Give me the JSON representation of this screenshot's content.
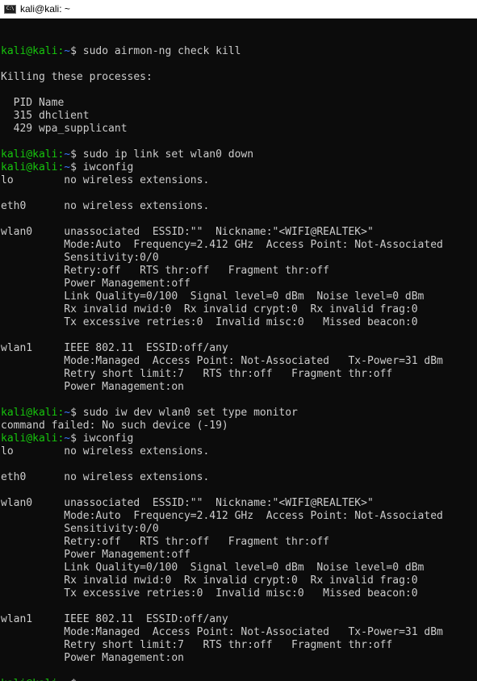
{
  "window": {
    "title": "kali@kali: ~",
    "icon_text": "C:\\"
  },
  "prompt": {
    "user": "kali@kali",
    "sep": ":",
    "path": "~",
    "symbol": "$"
  },
  "lines": [
    {
      "type": "blank"
    },
    {
      "type": "cmd",
      "cmd": " sudo airmon-ng check kill"
    },
    {
      "type": "blank"
    },
    {
      "type": "out",
      "text": "Killing these processes:"
    },
    {
      "type": "blank"
    },
    {
      "type": "out",
      "text": "  PID Name"
    },
    {
      "type": "out",
      "text": "  315 dhclient"
    },
    {
      "type": "out",
      "text": "  429 wpa_supplicant"
    },
    {
      "type": "blank"
    },
    {
      "type": "cmd",
      "cmd": " sudo ip link set wlan0 down"
    },
    {
      "type": "cmd",
      "cmd": " iwconfig"
    },
    {
      "type": "out",
      "text": "lo        no wireless extensions."
    },
    {
      "type": "blank"
    },
    {
      "type": "out",
      "text": "eth0      no wireless extensions."
    },
    {
      "type": "blank"
    },
    {
      "type": "out",
      "text": "wlan0     unassociated  ESSID:\"\"  Nickname:\"<WIFI@REALTEK>\""
    },
    {
      "type": "out",
      "text": "          Mode:Auto  Frequency=2.412 GHz  Access Point: Not-Associated"
    },
    {
      "type": "out",
      "text": "          Sensitivity:0/0"
    },
    {
      "type": "out",
      "text": "          Retry:off   RTS thr:off   Fragment thr:off"
    },
    {
      "type": "out",
      "text": "          Power Management:off"
    },
    {
      "type": "out",
      "text": "          Link Quality=0/100  Signal level=0 dBm  Noise level=0 dBm"
    },
    {
      "type": "out",
      "text": "          Rx invalid nwid:0  Rx invalid crypt:0  Rx invalid frag:0"
    },
    {
      "type": "out",
      "text": "          Tx excessive retries:0  Invalid misc:0   Missed beacon:0"
    },
    {
      "type": "blank"
    },
    {
      "type": "out",
      "text": "wlan1     IEEE 802.11  ESSID:off/any"
    },
    {
      "type": "out",
      "text": "          Mode:Managed  Access Point: Not-Associated   Tx-Power=31 dBm"
    },
    {
      "type": "out",
      "text": "          Retry short limit:7   RTS thr:off   Fragment thr:off"
    },
    {
      "type": "out",
      "text": "          Power Management:on"
    },
    {
      "type": "blank"
    },
    {
      "type": "cmd",
      "cmd": " sudo iw dev wlan0 set type monitor"
    },
    {
      "type": "out",
      "text": "command failed: No such device (-19)"
    },
    {
      "type": "cmd",
      "cmd": " iwconfig"
    },
    {
      "type": "out",
      "text": "lo        no wireless extensions."
    },
    {
      "type": "blank"
    },
    {
      "type": "out",
      "text": "eth0      no wireless extensions."
    },
    {
      "type": "blank"
    },
    {
      "type": "out",
      "text": "wlan0     unassociated  ESSID:\"\"  Nickname:\"<WIFI@REALTEK>\""
    },
    {
      "type": "out",
      "text": "          Mode:Auto  Frequency=2.412 GHz  Access Point: Not-Associated"
    },
    {
      "type": "out",
      "text": "          Sensitivity:0/0"
    },
    {
      "type": "out",
      "text": "          Retry:off   RTS thr:off   Fragment thr:off"
    },
    {
      "type": "out",
      "text": "          Power Management:off"
    },
    {
      "type": "out",
      "text": "          Link Quality=0/100  Signal level=0 dBm  Noise level=0 dBm"
    },
    {
      "type": "out",
      "text": "          Rx invalid nwid:0  Rx invalid crypt:0  Rx invalid frag:0"
    },
    {
      "type": "out",
      "text": "          Tx excessive retries:0  Invalid misc:0   Missed beacon:0"
    },
    {
      "type": "blank"
    },
    {
      "type": "out",
      "text": "wlan1     IEEE 802.11  ESSID:off/any"
    },
    {
      "type": "out",
      "text": "          Mode:Managed  Access Point: Not-Associated   Tx-Power=31 dBm"
    },
    {
      "type": "out",
      "text": "          Retry short limit:7   RTS thr:off   Fragment thr:off"
    },
    {
      "type": "out",
      "text": "          Power Management:on"
    },
    {
      "type": "blank"
    },
    {
      "type": "cmd",
      "cmd": ""
    }
  ],
  "colors": {
    "background": "#0c0c0c",
    "text": "#cccccc",
    "prompt_user": "#16c60c",
    "prompt_path": "#3b78ff"
  }
}
